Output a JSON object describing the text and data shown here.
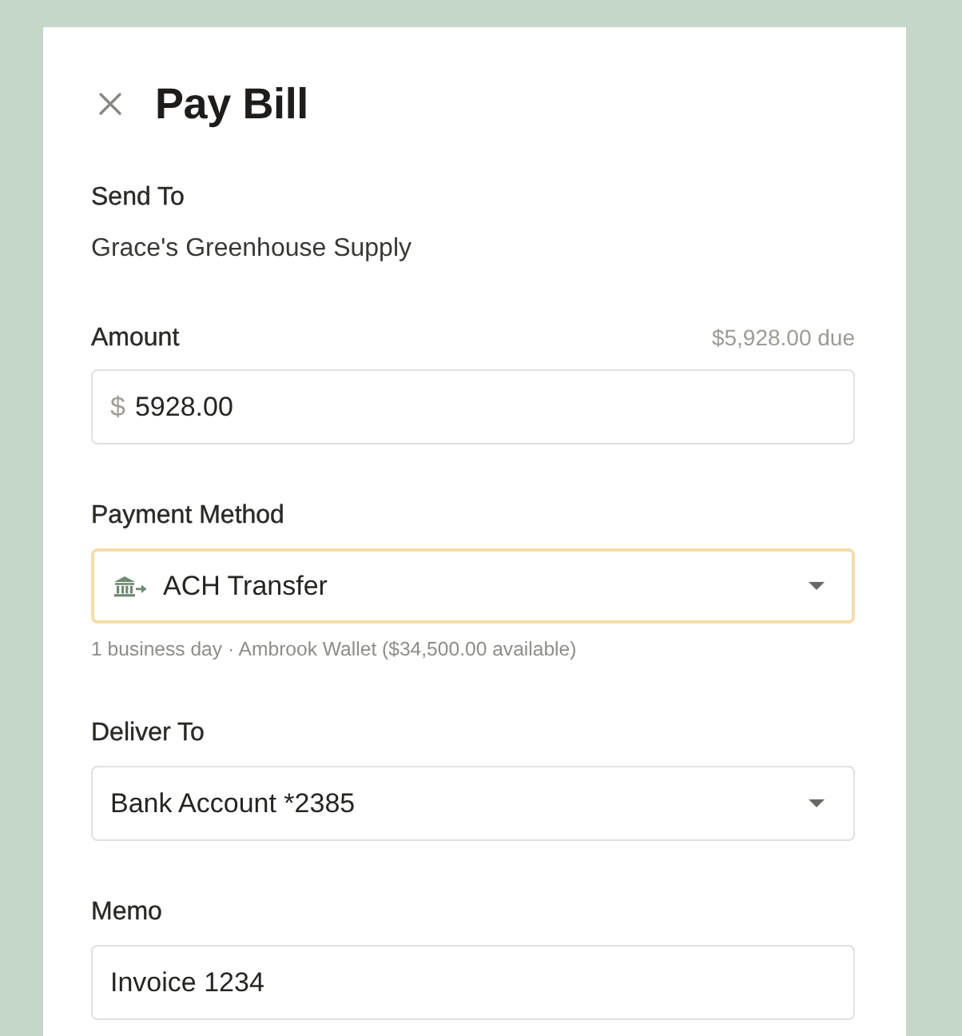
{
  "dialog": {
    "title": "Pay Bill"
  },
  "send_to": {
    "label": "Send To",
    "value": "Grace's Greenhouse Supply"
  },
  "fields": [
    {
      "kind": "currency",
      "label": "Amount",
      "note": "$5,928.00 due",
      "prefix": "$",
      "value": "5928.00",
      "focused": false
    },
    {
      "kind": "method-select",
      "label": "Payment Method",
      "value": "ACH Transfer",
      "focused": true,
      "help": "1 business day · Ambrook Wallet ($34,500.00 available)"
    },
    {
      "kind": "select",
      "label": "Deliver To",
      "value": "Bank Account *2385",
      "focused": false
    },
    {
      "kind": "text",
      "label": "Memo",
      "value": "Invoice 1234",
      "focused": false
    }
  ]
}
